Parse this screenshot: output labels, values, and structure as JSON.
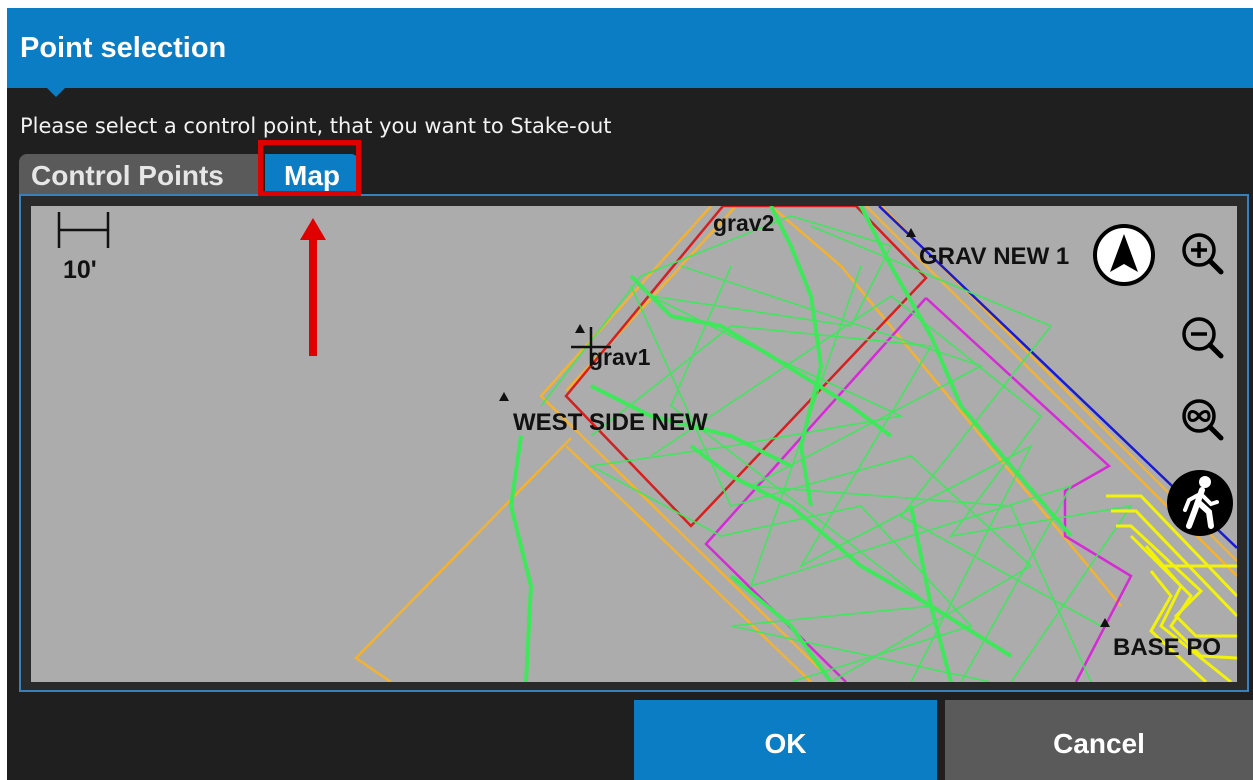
{
  "window": {
    "title": "Point selection",
    "prompt": "Please select a control point, that you want to Stake-out"
  },
  "tabs": [
    {
      "label": "Control Points",
      "selected": false
    },
    {
      "label": "Map",
      "selected": true
    }
  ],
  "map": {
    "scale_label": "10'",
    "points": [
      {
        "label": "grav2"
      },
      {
        "label": "GRAV NEW 1"
      },
      {
        "label": "grav1"
      },
      {
        "label": "WEST SIDE NEW"
      },
      {
        "label": "BASE PO"
      }
    ],
    "tools": [
      "north-arrow-icon",
      "zoom-in-icon",
      "zoom-out-icon",
      "zoom-extents-icon",
      "walk-icon"
    ]
  },
  "buttons": {
    "ok": "OK",
    "cancel": "Cancel"
  },
  "colors": {
    "accent": "#0b7dc4",
    "annotation": "#e00000",
    "map_background": "#acacac",
    "linework_green": "#3ee85a",
    "linework_orange": "#f2b233",
    "linework_red": "#d42020",
    "linework_magenta": "#d62ad6",
    "linework_blue": "#1a1ad0",
    "linework_yellow": "#f2f20a"
  }
}
